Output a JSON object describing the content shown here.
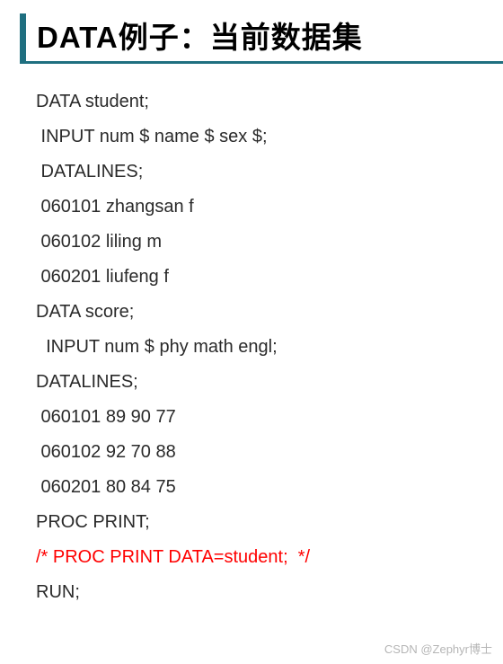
{
  "title": "DATA例子：当前数据集",
  "code": {
    "lines": [
      {
        "text": "DATA student;",
        "red": false,
        "indent": 0
      },
      {
        "text": "INPUT num $ name $ sex $;",
        "red": false,
        "indent": 1
      },
      {
        "text": "DATALINES;",
        "red": false,
        "indent": 1
      },
      {
        "text": "060101 zhangsan f",
        "red": false,
        "indent": 1
      },
      {
        "text": "060102 liling m",
        "red": false,
        "indent": 1
      },
      {
        "text": "060201 liufeng f",
        "red": false,
        "indent": 1
      },
      {
        "text": "DATA score;",
        "red": false,
        "indent": 0
      },
      {
        "text": "INPUT num $ phy math engl;",
        "red": false,
        "indent": 2
      },
      {
        "text": "DATALINES;",
        "red": false,
        "indent": 0
      },
      {
        "text": "060101 89 90 77",
        "red": false,
        "indent": 1
      },
      {
        "text": "060102 92 70 88",
        "red": false,
        "indent": 1
      },
      {
        "text": "060201 80 84 75",
        "red": false,
        "indent": 1
      },
      {
        "text": "PROC PRINT;",
        "red": false,
        "indent": 0
      },
      {
        "text": "/* PROC PRINT DATA=student;  */",
        "red": true,
        "indent": 0
      },
      {
        "text": "RUN;",
        "red": false,
        "indent": 0
      }
    ]
  },
  "watermark": "CSDN @Zephyr博士"
}
